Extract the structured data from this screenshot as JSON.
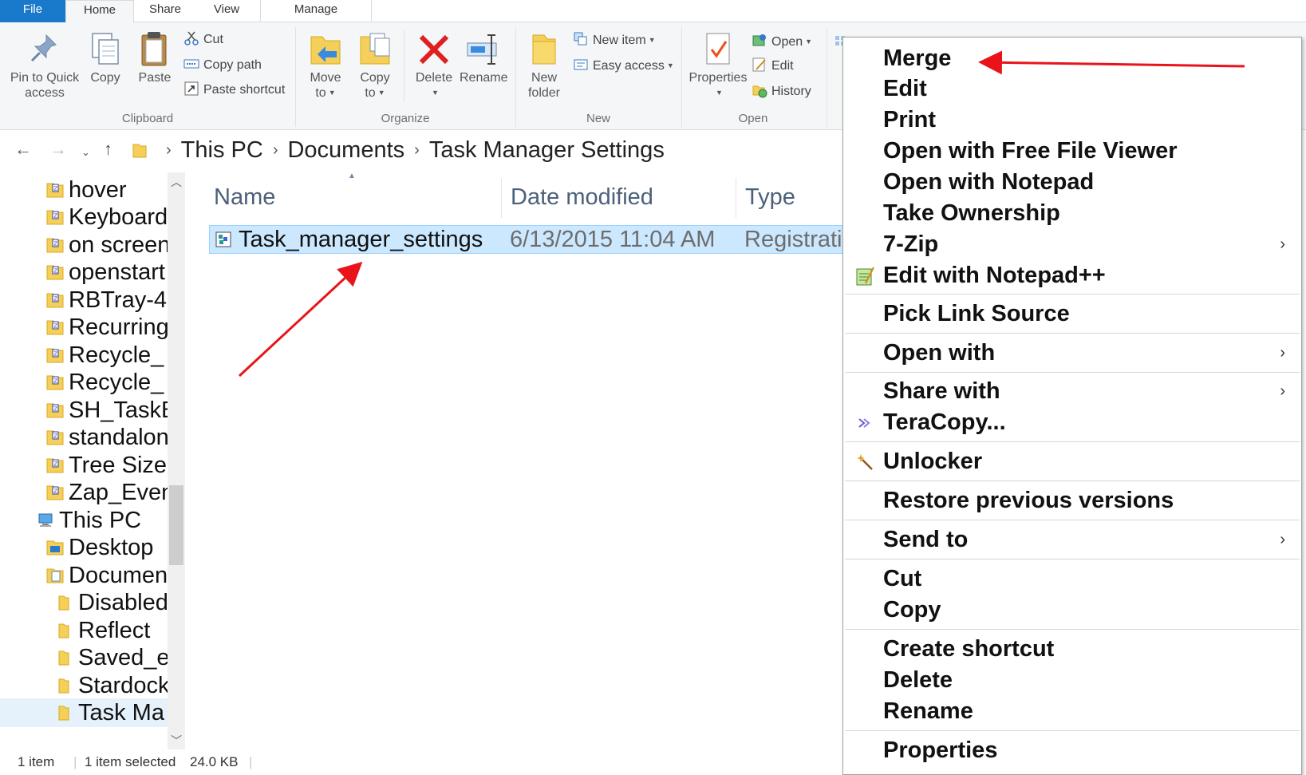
{
  "ribbon": {
    "tabs": [
      "File",
      "Home",
      "Share",
      "View",
      "Manage"
    ],
    "clipboard": {
      "label": "Clipboard",
      "pin": "Pin to Quick",
      "pin2": "access",
      "copy": "Copy",
      "paste": "Paste",
      "cut": "Cut",
      "copy_path": "Copy path",
      "paste_shortcut": "Paste shortcut"
    },
    "organize": {
      "label": "Organize",
      "move_to": "Move",
      "move_to2": "to",
      "copy_to": "Copy",
      "copy_to2": "to",
      "delete": "Delete",
      "rename": "Rename"
    },
    "new": {
      "label": "New",
      "new_folder": "New",
      "new_folder2": "folder",
      "new_item": "New item",
      "easy_access": "Easy access"
    },
    "open": {
      "label": "Open",
      "properties": "Properties",
      "open": "Open",
      "edit": "Edit",
      "history": "History"
    }
  },
  "address": {
    "crumbs": [
      "This PC",
      "Documents",
      "Task Manager Settings"
    ]
  },
  "nav": {
    "items": [
      "hover",
      "Keyboard",
      "on screen",
      "openstart",
      "RBTray-4",
      "Recurring",
      "Recycle_",
      "Recycle_",
      "SH_TaskB",
      "standalon",
      "Tree Size",
      "Zap_Even"
    ],
    "this_pc": "This PC",
    "desktop": "Desktop",
    "documents": "Documents",
    "sub": [
      "Disabled",
      "Reflect",
      "Saved_e",
      "Stardock",
      "Task Ma"
    ]
  },
  "filelist": {
    "columns": [
      "Name",
      "Date modified",
      "Type"
    ],
    "rows": [
      {
        "name": "Task_manager_settings",
        "date": "6/13/2015 11:04 AM",
        "type": "Registration"
      }
    ]
  },
  "status": {
    "count": "1 item",
    "selected": "1 item selected",
    "size": "24.0 KB"
  },
  "context_menu": {
    "items": [
      "Merge",
      "Edit",
      "Print",
      "Open with Free File Viewer",
      "Open with Notepad",
      "Take Ownership",
      "7-Zip",
      "Edit with Notepad++",
      "Pick Link Source",
      "Open with",
      "Share with",
      "TeraCopy...",
      "Unlocker",
      "Restore previous versions",
      "Send to",
      "Cut",
      "Copy",
      "Create shortcut",
      "Delete",
      "Rename",
      "Properties"
    ],
    "submenu_glyph": "›"
  },
  "colors": {
    "accent": "#1979ca",
    "selection": "#cce8ff",
    "annotation_arrow": "#e8141a"
  }
}
